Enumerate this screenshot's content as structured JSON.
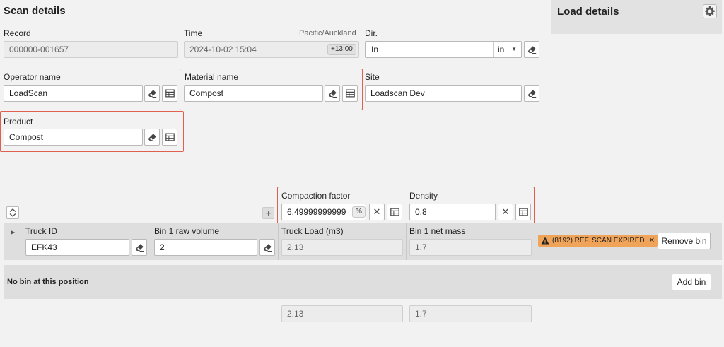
{
  "scan_details": {
    "title": "Scan details"
  },
  "load_details": {
    "title": "Load details"
  },
  "record": {
    "label": "Record",
    "value": "000000-001657"
  },
  "time": {
    "label": "Time",
    "timezone": "Pacific/Auckland",
    "value": "2024-10-02 15:04",
    "offset": "+13:00"
  },
  "dir": {
    "label": "Dir.",
    "value": "In",
    "select_value": "in"
  },
  "operator": {
    "label": "Operator name",
    "value": "LoadScan"
  },
  "material": {
    "label": "Material name",
    "value": "Compost"
  },
  "site": {
    "label": "Site",
    "value": "Loadscan Dev"
  },
  "product": {
    "label": "Product",
    "value": "Compost"
  },
  "compaction": {
    "label": "Compaction factor",
    "value": "6.49999999999",
    "unit": "%"
  },
  "density": {
    "label": "Density",
    "value": "0.8"
  },
  "bin_row": {
    "truck_id": {
      "label": "Truck ID",
      "value": "EFK43"
    },
    "raw_volume": {
      "label": "Bin 1 raw volume",
      "value": "2"
    },
    "truck_load": {
      "label": "Truck Load (m3)",
      "value": "2.13"
    },
    "net_mass": {
      "label": "Bin 1 net mass",
      "value": "1.7"
    },
    "warning": "(8192) REF. SCAN EXPIRED",
    "remove_label": "Remove bin"
  },
  "empty_bin": {
    "text": "No bin at this position",
    "add_label": "Add bin"
  },
  "totals": {
    "load": "2.13",
    "mass": "1.7"
  },
  "colors": {
    "highlight": "#e06050",
    "warning": "#f0a45a",
    "panel": "#dedede"
  }
}
